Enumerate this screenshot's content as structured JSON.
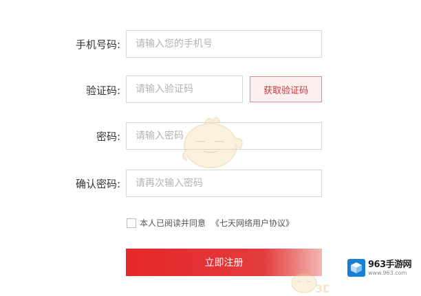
{
  "form": {
    "phone": {
      "label": "手机号码:",
      "placeholder": "请输入您的手机号"
    },
    "code": {
      "label": "验证码:",
      "placeholder": "请输入验证码",
      "button": "获取验证码"
    },
    "password": {
      "label": "密码:",
      "placeholder": "请输入密码"
    },
    "confirm": {
      "label": "确认密码:",
      "placeholder": "请再次输入密码"
    },
    "agreement": {
      "text": "本人已阅读并同意",
      "link": "《七天网络用户协议》",
      "checked": false
    },
    "submit": "立即注册"
  },
  "watermark": {
    "logo_main": "963手游网",
    "logo_sub": "www.963.com"
  },
  "colors": {
    "primary_red": "#e5272a",
    "code_button_border": "#e4898a",
    "code_button_bg": "#fdefef",
    "logo_blue": "#1a7ed1"
  }
}
